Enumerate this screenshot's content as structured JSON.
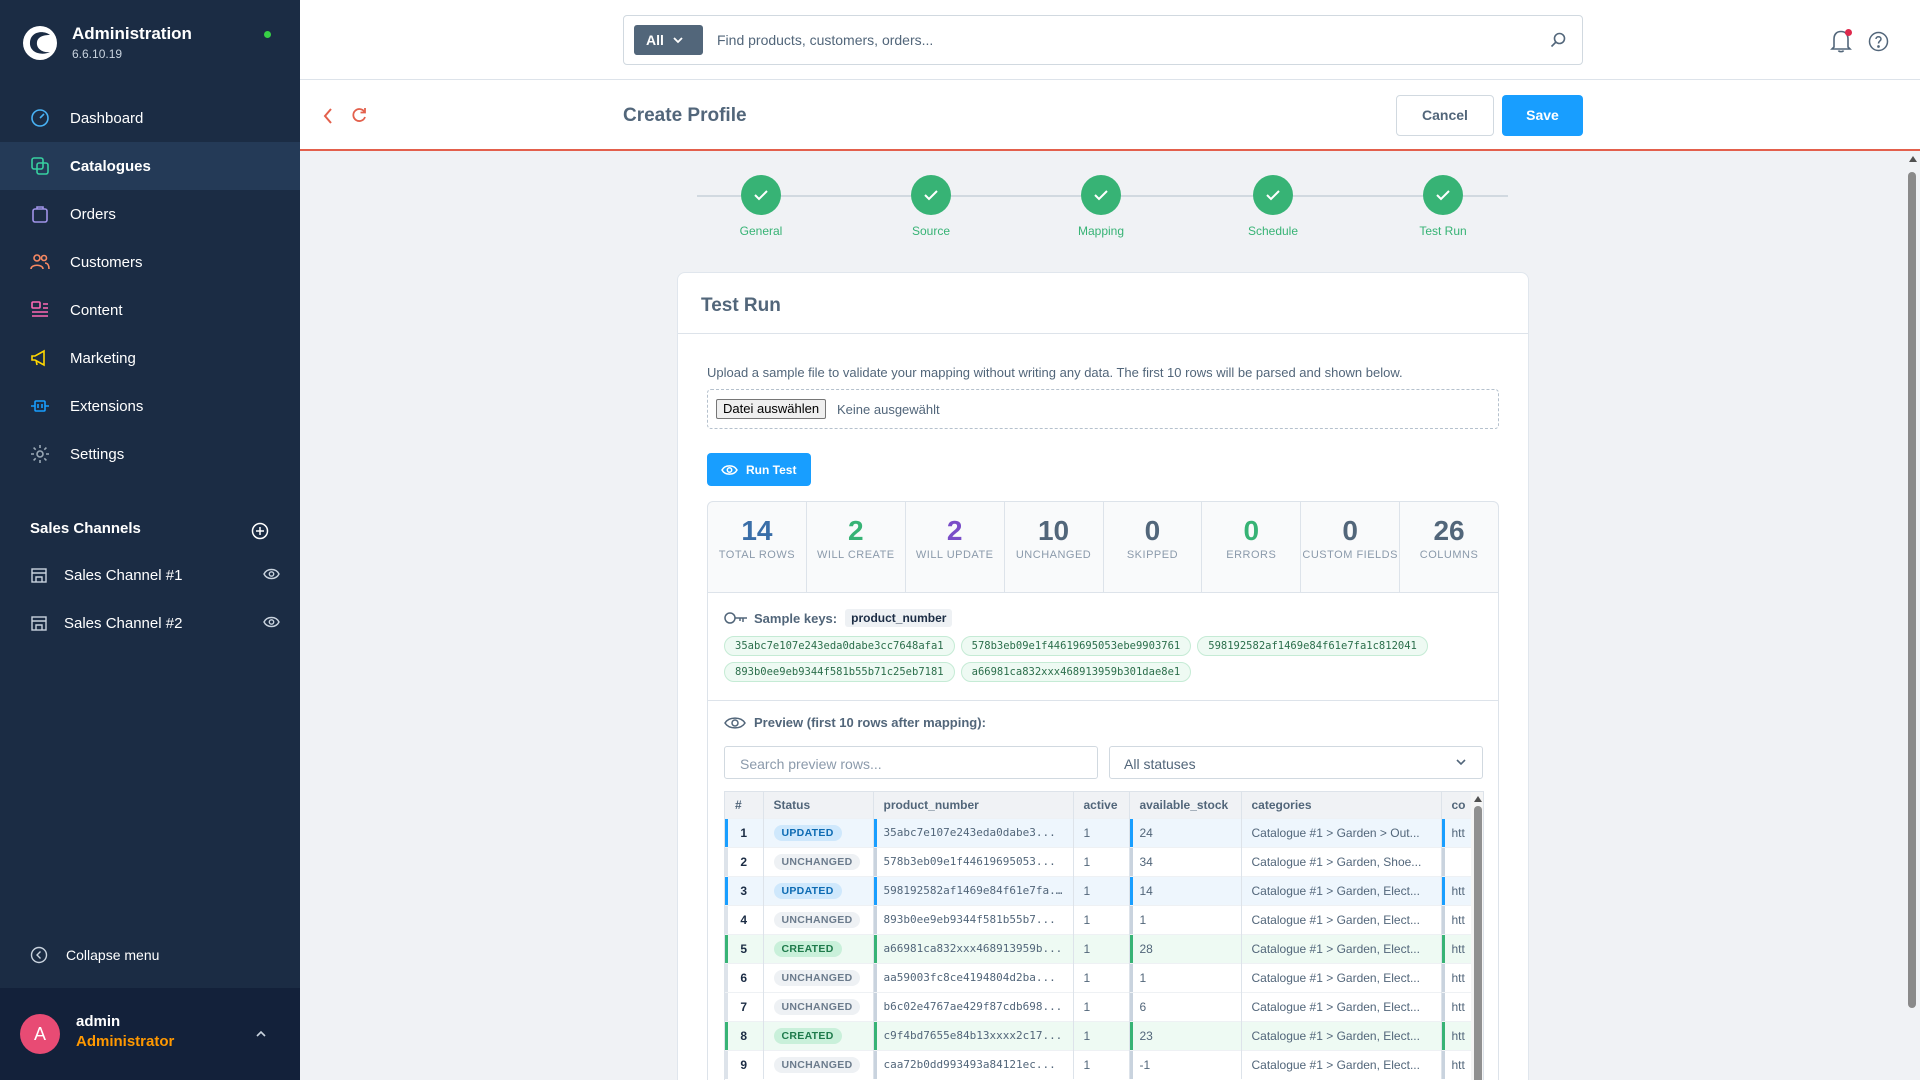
{
  "app": {
    "title": "Administration",
    "version": "6.6.10.19"
  },
  "colors": {
    "sidebar": "#1b2c44",
    "accent": "#189eff",
    "success": "#37b375",
    "danger": "#e3604c"
  },
  "nav": [
    {
      "label": "Dashboard",
      "icon": "gauge-icon"
    },
    {
      "label": "Catalogues",
      "icon": "catalogue-icon",
      "active": true
    },
    {
      "label": "Orders",
      "icon": "bag-icon"
    },
    {
      "label": "Customers",
      "icon": "users-icon"
    },
    {
      "label": "Content",
      "icon": "content-icon"
    },
    {
      "label": "Marketing",
      "icon": "megaphone-icon"
    },
    {
      "label": "Extensions",
      "icon": "plug-icon"
    },
    {
      "label": "Settings",
      "icon": "gear-icon"
    }
  ],
  "sales_channels": {
    "title": "Sales Channels",
    "items": [
      {
        "label": "Sales Channel #1"
      },
      {
        "label": "Sales Channel #2"
      }
    ]
  },
  "sidebar": {
    "collapse_label": "Collapse menu"
  },
  "user": {
    "initial": "A",
    "name": "admin",
    "role": "Administrator"
  },
  "search": {
    "scope": "All",
    "placeholder": "Find products, customers, orders..."
  },
  "header": {
    "title": "Create Profile",
    "cancel_label": "Cancel",
    "save_label": "Save"
  },
  "steps": [
    {
      "label": "General"
    },
    {
      "label": "Source"
    },
    {
      "label": "Mapping"
    },
    {
      "label": "Schedule"
    },
    {
      "label": "Test Run"
    }
  ],
  "test_run": {
    "title": "Test Run",
    "description": "Upload a sample file to validate your mapping without writing any data. The first 10 rows will be parsed and shown below.",
    "file_button": "Datei auswählen",
    "file_status": "Keine ausgewählt",
    "run_label": "Run Test",
    "stats": [
      {
        "value": "14",
        "label": "TOTAL ROWS",
        "color": "#3a6ea8"
      },
      {
        "value": "2",
        "label": "WILL CREATE",
        "color": "#37b375"
      },
      {
        "value": "2",
        "label": "WILL UPDATE",
        "color": "#7a4dc8"
      },
      {
        "value": "10",
        "label": "UNCHANGED",
        "color": "#52667a"
      },
      {
        "value": "0",
        "label": "SKIPPED",
        "color": "#52667a"
      },
      {
        "value": "0",
        "label": "ERRORS",
        "color": "#37b375"
      },
      {
        "value": "0",
        "label": "CUSTOM FIELDS",
        "color": "#52667a"
      },
      {
        "value": "26",
        "label": "COLUMNS",
        "color": "#52667a"
      }
    ],
    "sample_keys_label": "Sample keys:",
    "sample_key_field": "product_number",
    "sample_keys": [
      "35abc7e107e243eda0dabe3cc7648afa1",
      "578b3eb09e1f44619695053ebe9903761",
      "598192582af1469e84f61e7fa1c812041",
      "893b0ee9eb9344f581b55b71c25eb7181",
      "a66981ca832xxx468913959b301dae8e1"
    ],
    "preview_label": "Preview (first 10 rows after mapping):",
    "preview_search_placeholder": "Search preview rows...",
    "status_filter": "All statuses",
    "columns": [
      "#",
      "Status",
      "product_number",
      "active",
      "available_stock",
      "categories",
      "co"
    ],
    "rows": [
      {
        "n": "1",
        "status": "UPDATED",
        "product_number": "35abc7e107e243eda0dabe3...",
        "active": "1",
        "stock": "24",
        "categories": "Catalogue #1 > Garden > Out...",
        "co": "htt"
      },
      {
        "n": "2",
        "status": "UNCHANGED",
        "product_number": "578b3eb09e1f44619695053...",
        "active": "1",
        "stock": "34",
        "categories": "Catalogue #1 > Garden, Shoe...",
        "co": ""
      },
      {
        "n": "3",
        "status": "UPDATED",
        "product_number": "598192582af1469e84f61e7fa...",
        "active": "1",
        "stock": "14",
        "categories": "Catalogue #1 > Garden, Elect...",
        "co": "htt"
      },
      {
        "n": "4",
        "status": "UNCHANGED",
        "product_number": "893b0ee9eb9344f581b55b7...",
        "active": "1",
        "stock": "1",
        "categories": "Catalogue #1 > Garden, Elect...",
        "co": "htt"
      },
      {
        "n": "5",
        "status": "CREATED",
        "product_number": "a66981ca832xxx468913959b...",
        "active": "1",
        "stock": "28",
        "categories": "Catalogue #1 > Garden, Elect...",
        "co": "htt"
      },
      {
        "n": "6",
        "status": "UNCHANGED",
        "product_number": "aa59003fc8ce4194804d2ba...",
        "active": "1",
        "stock": "1",
        "categories": "Catalogue #1 > Garden, Elect...",
        "co": "htt"
      },
      {
        "n": "7",
        "status": "UNCHANGED",
        "product_number": "b6c02e4767ae429f87cdb698...",
        "active": "1",
        "stock": "6",
        "categories": "Catalogue #1 > Garden, Elect...",
        "co": "htt"
      },
      {
        "n": "8",
        "status": "CREATED",
        "product_number": "c9f4bd7655e84b13xxxx2c17...",
        "active": "1",
        "stock": "23",
        "categories": "Catalogue #1 > Garden, Elect...",
        "co": "htt"
      },
      {
        "n": "9",
        "status": "UNCHANGED",
        "product_number": "caa72b0dd993493a84121ec...",
        "active": "1",
        "stock": "-1",
        "categories": "Catalogue #1 > Garden, Elect...",
        "co": "htt"
      }
    ]
  }
}
